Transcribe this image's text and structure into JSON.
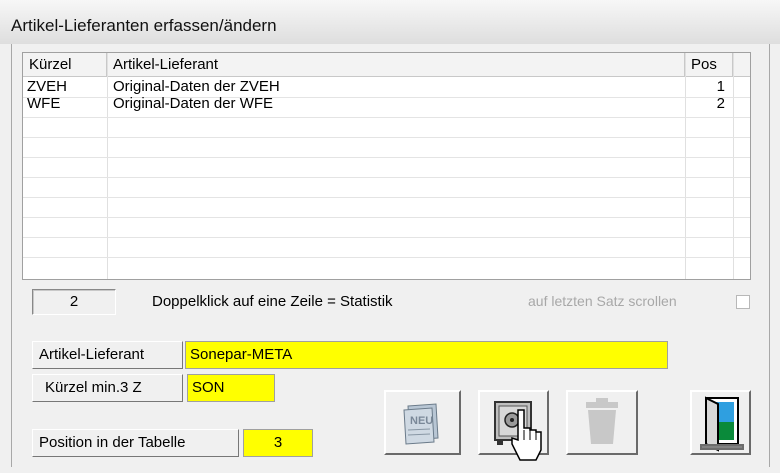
{
  "window": {
    "title": "Artikel-Lieferanten erfassen/ändern"
  },
  "table": {
    "columns": [
      "Kürzel",
      "Artikel-Lieferant",
      "Pos"
    ],
    "rows": [
      {
        "kuerzel": "ZVEH",
        "lieferant": "Original-Daten der ZVEH",
        "pos": "1"
      },
      {
        "kuerzel": "WFE",
        "lieferant": "Original-Daten der WFE",
        "pos": "2"
      }
    ]
  },
  "status": {
    "count": "2",
    "hint": "Doppelklick auf eine Zeile = Statistik",
    "scroll_label": "auf letzten Satz scrollen",
    "scroll_checked": false
  },
  "form": {
    "lieferant_label": "Artikel-Lieferant",
    "lieferant_value": "Sonepar-META",
    "kuerzel_label": "Kürzel min.3 Z",
    "kuerzel_value": "SON",
    "position_label": "Position in der Tabelle",
    "position_value": "3"
  },
  "buttons": {
    "new_label": "NEU",
    "save_icon": "safe-icon",
    "delete_icon": "trash-icon",
    "exit_icon": "exit-door-icon"
  },
  "colors": {
    "input_bg": "#ffff00"
  }
}
